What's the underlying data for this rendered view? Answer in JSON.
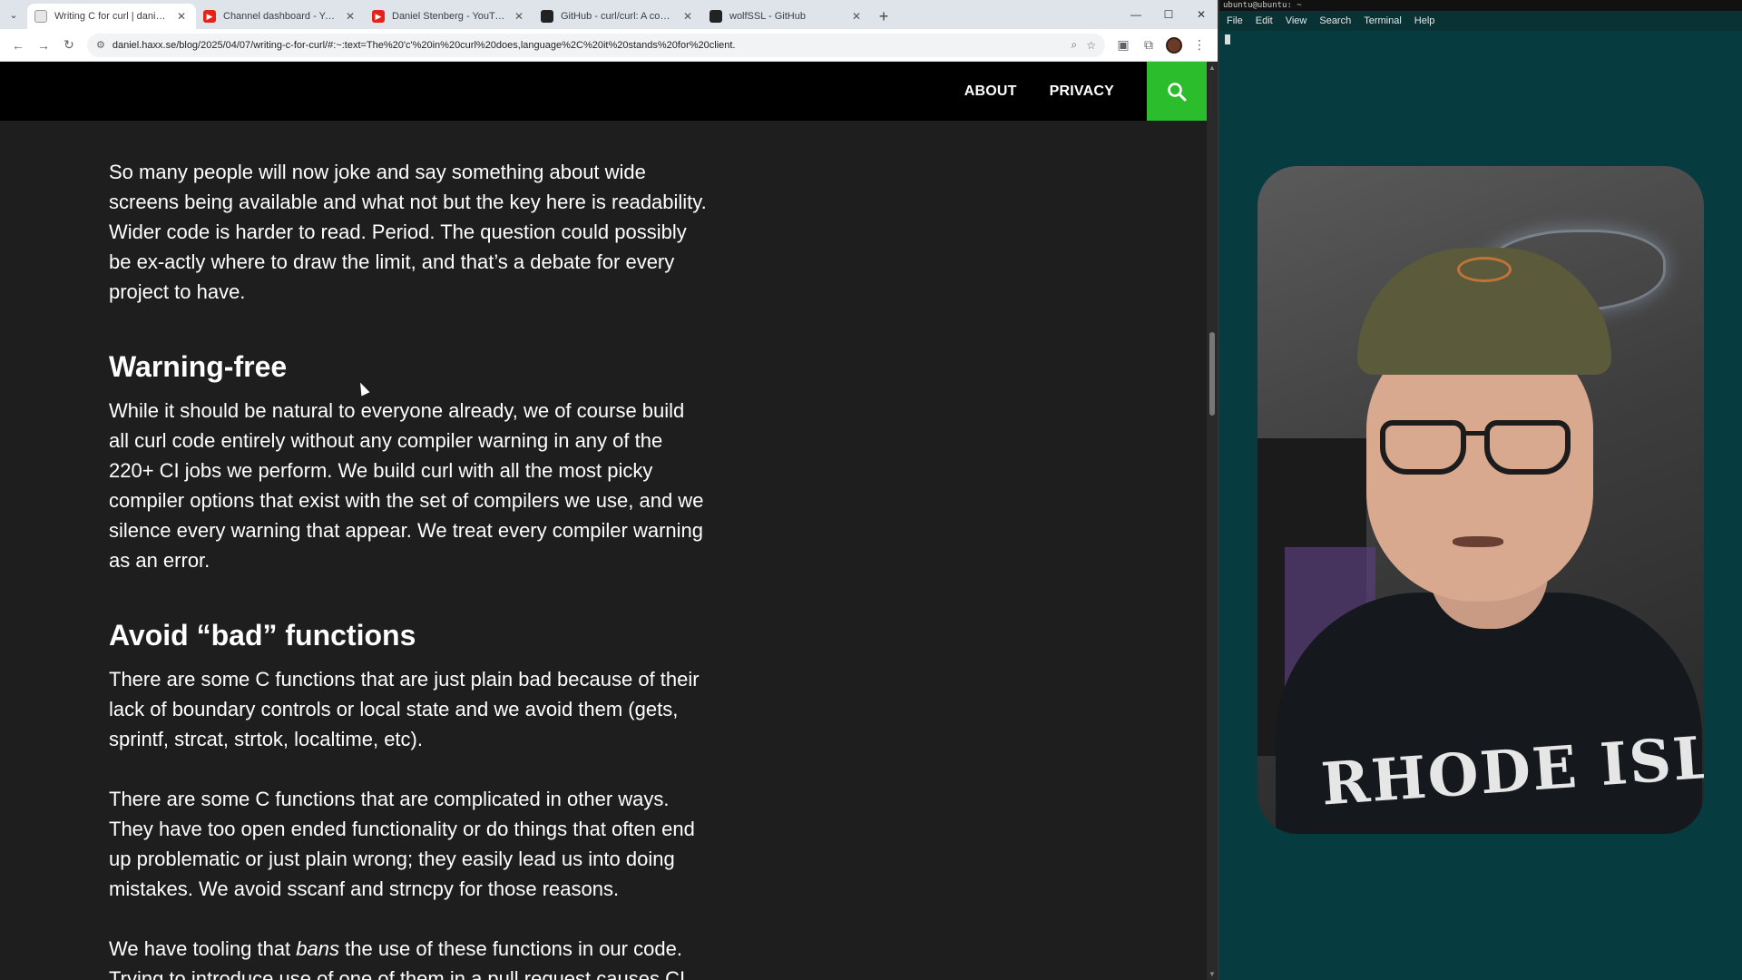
{
  "browser": {
    "tabs": [
      {
        "title": "Writing C for curl | daniel.haxx.se",
        "favicon": "page-icon",
        "active": true
      },
      {
        "title": "Channel dashboard - YouTube",
        "favicon": "youtube-icon",
        "active": false
      },
      {
        "title": "Daniel Stenberg - YouTube",
        "favicon": "youtube-icon",
        "active": false
      },
      {
        "title": "GitHub - curl/curl: A command line tool",
        "favicon": "github-icon",
        "active": false
      },
      {
        "title": "wolfSSL - GitHub",
        "favicon": "github-icon",
        "active": false
      }
    ],
    "url": "daniel.haxx.se/blog/2025/04/07/writing-c-for-curl/#:~:text=The%20'c'%20in%20curl%20does,language%2C%20it%20stands%20for%20client."
  },
  "site": {
    "nav": {
      "about": "ABOUT",
      "privacy": "PRIVACY"
    },
    "accent": "#2bbd2b"
  },
  "article": {
    "p1": "So many people will now joke and say something about wide screens being available and what not but the key here is readability. Wider code is harder to read. Period. The question could possibly be ex-actly where to draw the limit, and that’s a debate for every project to have.",
    "h_warning": "Warning-free",
    "p2": "While it should be natural to everyone already, we of course build all curl code entirely without any compiler warning in any of the 220+ CI jobs we perform. We build curl with all the most picky compiler options that exist with the set of compilers we use, and we silence every warning that appear. We treat every compiler warning as an error.",
    "h_bad": "Avoid “bad” functions",
    "p3": "There are some C functions that are just plain bad because of their lack of boundary controls or local state and we avoid them (gets, sprintf, strcat, strtok, localtime, etc).",
    "p4": "There are some C functions that are complicated in other ways. They have too open ended functionality or do things that often end up problematic or just plain wrong; they easily lead us into doing mistakes. We avoid sscanf and strncpy for those reasons.",
    "p5_pre": "We have tooling that ",
    "p5_em": "bans",
    "p5_post": " the use of these functions in our code. Trying to introduce use of one of them in a pull request causes CI"
  },
  "terminal": {
    "title": "ubuntu@ubuntu: ~",
    "menu": [
      "File",
      "Edit",
      "View",
      "Search",
      "Terminal",
      "Help"
    ],
    "bg": "#063c3f"
  },
  "webcam": {
    "shirt_text": "RHODE ISLAND"
  }
}
